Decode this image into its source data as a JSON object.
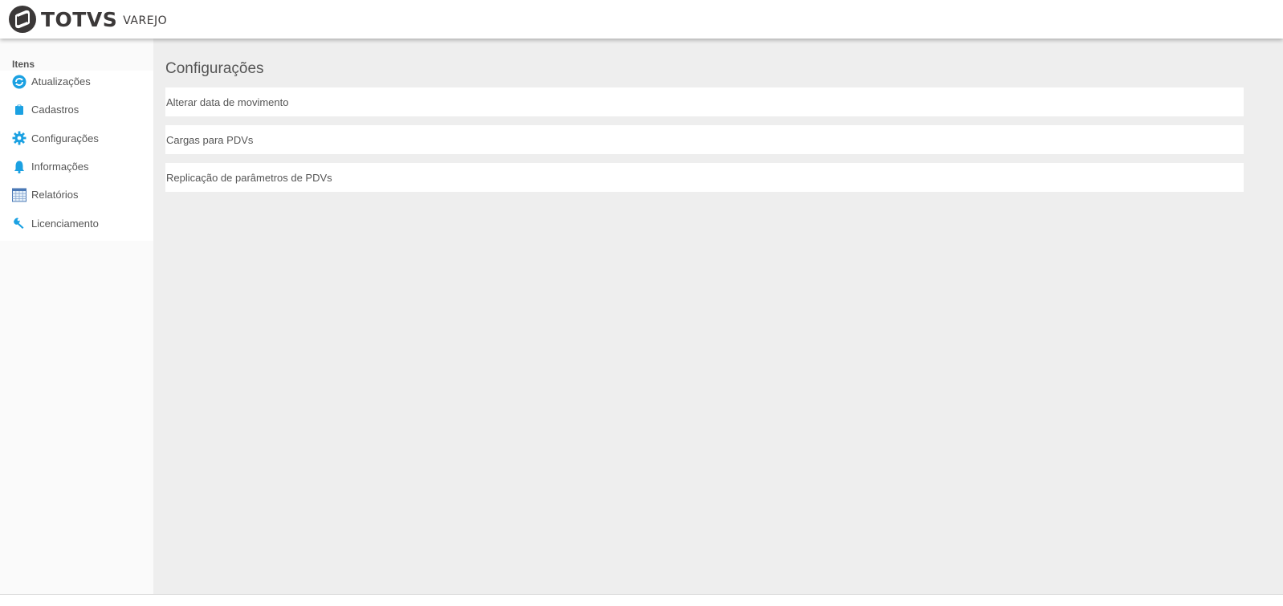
{
  "header": {
    "brand": "TOTVS",
    "product": "VAREJO"
  },
  "sidebar": {
    "title": "Itens",
    "items": [
      {
        "label": "Atualizações",
        "icon": "refresh-icon"
      },
      {
        "label": "Cadastros",
        "icon": "clipboard-icon"
      },
      {
        "label": "Configurações",
        "icon": "gear-icon"
      },
      {
        "label": "Informações",
        "icon": "bell-icon"
      },
      {
        "label": "Relatórios",
        "icon": "spreadsheet-icon"
      },
      {
        "label": "Licenciamento",
        "icon": "wrench-icon"
      }
    ]
  },
  "main": {
    "title": "Configurações",
    "items": [
      {
        "label": "Alterar data de movimento"
      },
      {
        "label": "Cargas para PDVs"
      },
      {
        "label": "Replicação de parâmetros de PDVs"
      }
    ]
  },
  "colors": {
    "accent": "#1ba1e2",
    "logo": "#3b3838",
    "background": "#eeeeee"
  }
}
